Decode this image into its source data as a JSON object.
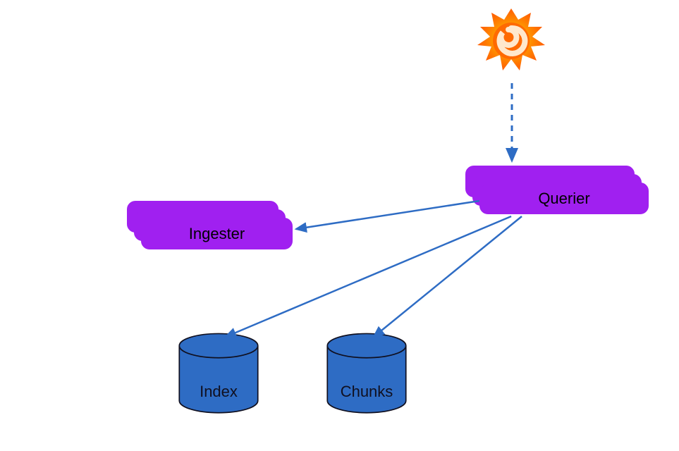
{
  "nodes": {
    "grafana": {
      "name": "Grafana"
    },
    "querier": {
      "label": "Querier"
    },
    "ingester": {
      "label": "Ingester"
    },
    "index": {
      "label": "Index"
    },
    "chunks": {
      "label": "Chunks"
    }
  },
  "edges": [
    {
      "from": "grafana",
      "to": "querier",
      "style": "dashed"
    },
    {
      "from": "querier",
      "to": "ingester",
      "style": "solid"
    },
    {
      "from": "querier",
      "to": "index",
      "style": "solid"
    },
    {
      "from": "querier",
      "to": "chunks",
      "style": "solid"
    }
  ],
  "colors": {
    "node_fill": "#a020f0",
    "cylinder_fill": "#2e6cc4",
    "arrow": "#2e6cc4",
    "cylinder_stroke": "#101020"
  }
}
